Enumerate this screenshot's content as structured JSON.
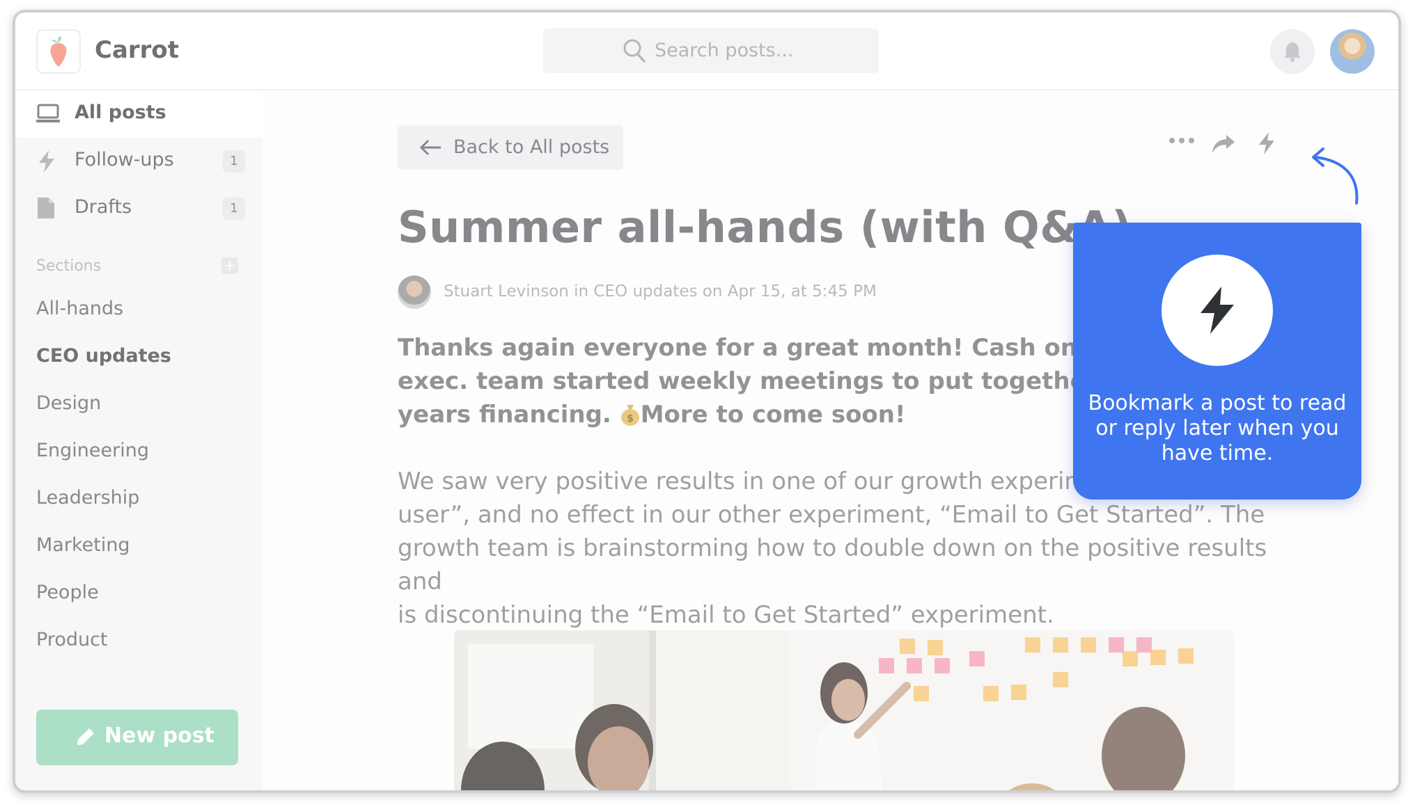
{
  "app": {
    "name": "Carrot"
  },
  "search": {
    "placeholder": "Search posts..."
  },
  "sidebar": {
    "nav": [
      {
        "label": "All posts",
        "icon": "laptop-icon"
      },
      {
        "label": "Follow-ups",
        "icon": "bolt-icon",
        "count": "1"
      },
      {
        "label": "Drafts",
        "icon": "document-icon",
        "count": "1"
      }
    ],
    "sections_title": "Sections",
    "sections_add": "+",
    "sections": [
      "All-hands",
      "CEO updates",
      "Design",
      "Engineering",
      "Leadership",
      "Marketing",
      "People",
      "Product"
    ],
    "selected_section": "CEO updates",
    "new_post_label": "New post"
  },
  "post": {
    "back_label": "Back to All posts",
    "title": "Summer all-hands (with Q&A)",
    "meta": "Stuart Levinson in CEO updates on Apr 15, at 5:45 PM",
    "para1_line1": "Thanks again everyone for a great month! Cash on hand is",
    "para1_line2": "exec. team started weekly meetings to put together the st",
    "para1_line3_a": "years financing.",
    "para1_line3_b": "More to come soon!",
    "para2_line1": "We saw very positive results in one of our growth experimen",
    "para2_line2": "user”, and no effect in our other experiment, “Email to Get Started”. The",
    "para2_line3": "growth team is brainstorming how to double down on the positive results and",
    "para2_line4": "is discontinuing the “Email to Get Started” experiment."
  },
  "tooltip": {
    "text": "Bookmark a post to read or reply later when you have time."
  },
  "colors": {
    "accent": "#3f75ef",
    "new_post": "#8bd3b0",
    "sidebar_bg": "#f4f4f6"
  }
}
